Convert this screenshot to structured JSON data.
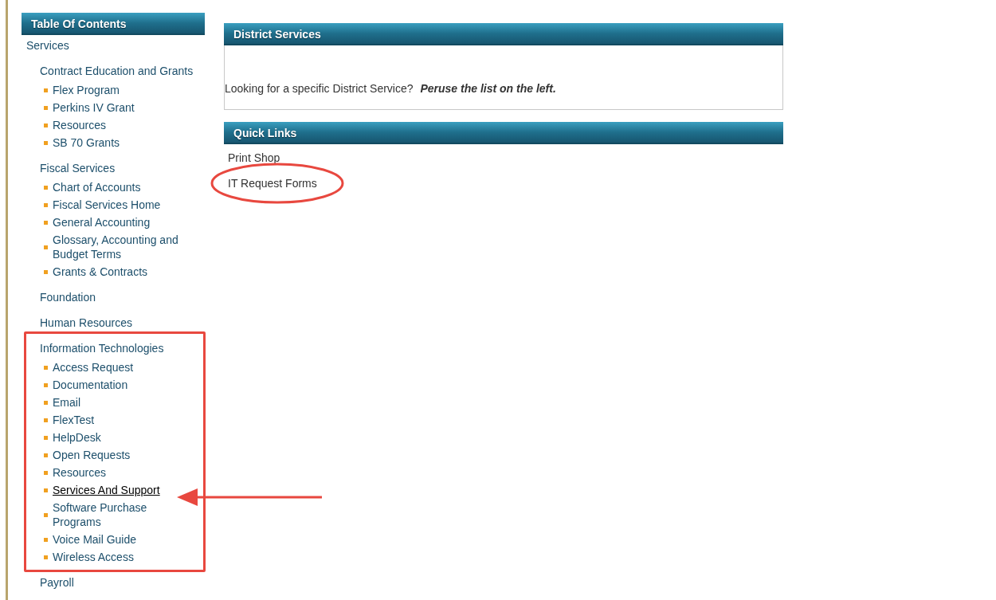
{
  "sidebar": {
    "title": "Table Of Contents",
    "section": "Services",
    "groups": [
      {
        "title": "Contract Education and Grants",
        "items": [
          {
            "label": "Flex Program",
            "selected": false
          },
          {
            "label": "Perkins IV Grant",
            "selected": false
          },
          {
            "label": "Resources",
            "selected": false
          },
          {
            "label": "SB 70 Grants",
            "selected": false
          }
        ]
      },
      {
        "title": "Fiscal Services",
        "items": [
          {
            "label": "Chart of Accounts",
            "selected": false
          },
          {
            "label": "Fiscal Services Home",
            "selected": false
          },
          {
            "label": "General Accounting",
            "selected": false
          },
          {
            "label": "Glossary, Accounting and Budget Terms",
            "selected": false
          },
          {
            "label": "Grants & Contracts",
            "selected": false
          }
        ]
      },
      {
        "title": "Foundation"
      },
      {
        "title": "Human Resources"
      },
      {
        "title": "Information Technologies",
        "items": [
          {
            "label": "Access Request",
            "selected": false
          },
          {
            "label": "Documentation",
            "selected": false
          },
          {
            "label": "Email",
            "selected": false
          },
          {
            "label": "FlexTest",
            "selected": false
          },
          {
            "label": "HelpDesk",
            "selected": false
          },
          {
            "label": "Open Requests",
            "selected": false
          },
          {
            "label": "Resources",
            "selected": false
          },
          {
            "label": "Services And Support",
            "selected": true
          },
          {
            "label": "Software Purchase Programs",
            "selected": false
          },
          {
            "label": "Voice Mail Guide",
            "selected": false
          },
          {
            "label": "Wireless Access",
            "selected": false
          }
        ]
      },
      {
        "title": "Payroll"
      }
    ]
  },
  "district_services": {
    "title": "District Services",
    "text": "Looking for a specific District Service?",
    "emphasis": "Peruse the list on the left."
  },
  "quick_links": {
    "title": "Quick Links",
    "links": [
      "Print Shop",
      "IT Request Forms"
    ]
  }
}
